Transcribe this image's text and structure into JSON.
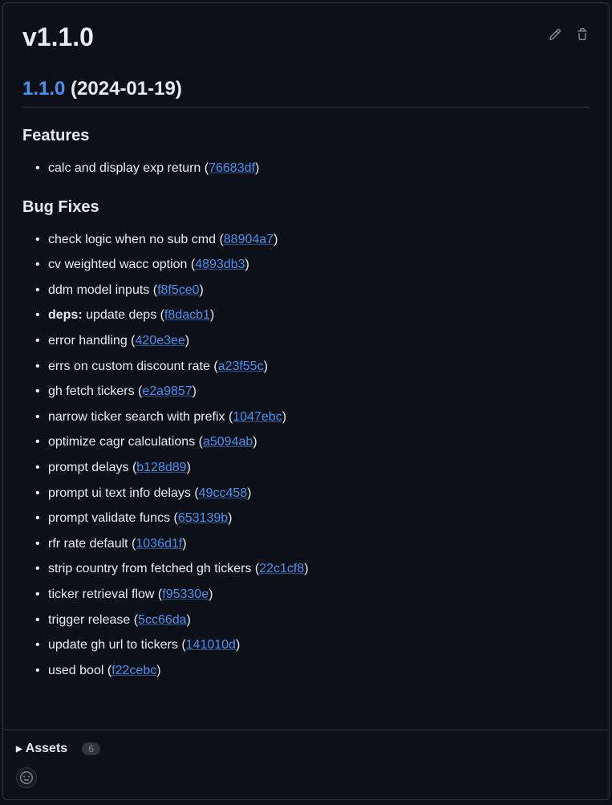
{
  "title": "v1.1.0",
  "version": {
    "link_text": "1.1.0",
    "date_text": " (2024-01-19)"
  },
  "sections": {
    "features": {
      "heading": "Features",
      "items": [
        {
          "text": "calc and display exp return ",
          "hash": "76683df"
        }
      ]
    },
    "bugfixes": {
      "heading": "Bug Fixes",
      "items": [
        {
          "text": "check logic when no sub cmd ",
          "hash": "88904a7"
        },
        {
          "text": "cv weighted wacc option ",
          "hash": "4893db3"
        },
        {
          "text": "ddm model inputs ",
          "hash": "f8f5ce0"
        },
        {
          "prefix": "deps:",
          "text": " update deps ",
          "hash": "f8dacb1"
        },
        {
          "text": "error handling ",
          "hash": "420e3ee"
        },
        {
          "text": "errs on custom discount rate ",
          "hash": "a23f55c"
        },
        {
          "text": "gh fetch tickers ",
          "hash": "e2a9857"
        },
        {
          "text": "narrow ticker search with prefix ",
          "hash": "1047ebc"
        },
        {
          "text": "optimize cagr calculations ",
          "hash": "a5094ab"
        },
        {
          "text": "prompt delays ",
          "hash": "b128d89"
        },
        {
          "text": "prompt ui text info delays ",
          "hash": "49cc458"
        },
        {
          "text": "prompt validate funcs ",
          "hash": "653139b"
        },
        {
          "text": "rfr rate default ",
          "hash": "1036d1f"
        },
        {
          "text": "strip country from fetched gh tickers ",
          "hash": "22c1cf8"
        },
        {
          "text": "ticker retrieval flow ",
          "hash": "f95330e"
        },
        {
          "text": "trigger release ",
          "hash": "5cc66da"
        },
        {
          "text": "update gh url to tickers ",
          "hash": "141010d"
        },
        {
          "text": "used bool ",
          "hash": "f22cebc"
        }
      ]
    }
  },
  "assets": {
    "label": "Assets",
    "count": "6"
  },
  "paren_open": "(",
  "paren_close": ")"
}
